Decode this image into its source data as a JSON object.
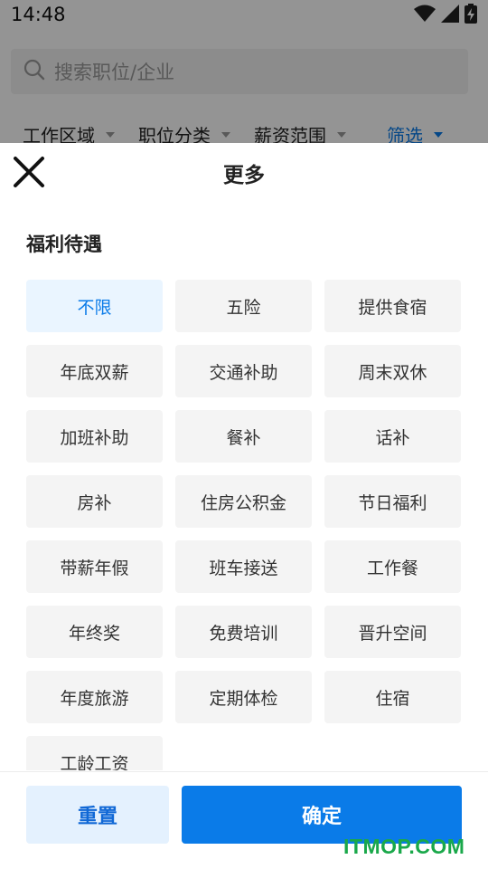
{
  "status_bar": {
    "time": "14:48",
    "icons": [
      "wifi-icon",
      "cellular-signal-icon",
      "battery-charging-icon"
    ]
  },
  "background": {
    "search_placeholder": "搜索职位/企业",
    "filters": [
      {
        "label": "工作区域",
        "active": false
      },
      {
        "label": "职位分类",
        "active": false
      },
      {
        "label": "薪资范围",
        "active": false
      },
      {
        "label": "筛选",
        "active": true
      }
    ]
  },
  "sheet": {
    "title": "更多",
    "section_title": "福利待遇",
    "options": [
      {
        "label": "不限",
        "selected": true
      },
      {
        "label": "五险",
        "selected": false
      },
      {
        "label": "提供食宿",
        "selected": false
      },
      {
        "label": "年底双薪",
        "selected": false
      },
      {
        "label": "交通补助",
        "selected": false
      },
      {
        "label": "周末双休",
        "selected": false
      },
      {
        "label": "加班补助",
        "selected": false
      },
      {
        "label": "餐补",
        "selected": false
      },
      {
        "label": "话补",
        "selected": false
      },
      {
        "label": "房补",
        "selected": false
      },
      {
        "label": "住房公积金",
        "selected": false
      },
      {
        "label": "节日福利",
        "selected": false
      },
      {
        "label": "带薪年假",
        "selected": false
      },
      {
        "label": "班车接送",
        "selected": false
      },
      {
        "label": "工作餐",
        "selected": false
      },
      {
        "label": "年终奖",
        "selected": false
      },
      {
        "label": "免费培训",
        "selected": false
      },
      {
        "label": "晋升空间",
        "selected": false
      },
      {
        "label": "年度旅游",
        "selected": false
      },
      {
        "label": "定期体检",
        "selected": false
      },
      {
        "label": "住宿",
        "selected": false
      },
      {
        "label": "工龄工资",
        "selected": false
      }
    ],
    "reset_label": "重置",
    "confirm_label": "确定"
  },
  "watermark": "ITMOP.COM",
  "colors": {
    "accent": "#0a7be8",
    "selected_bg": "#eaf5ff",
    "chip_bg": "#f4f4f4",
    "reset_bg": "#e4f1fe",
    "watermark": "#1aa84a"
  }
}
